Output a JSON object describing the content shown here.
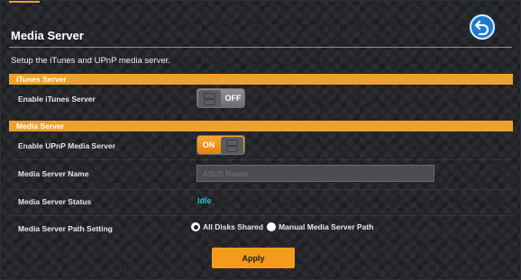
{
  "header": {
    "title": "Media Server",
    "subtitle": "Setup the iTunes and UPnP media server."
  },
  "back_button": {
    "icon": "back-arrow-icon"
  },
  "itunes_section": {
    "title": "iTunes Server",
    "enable_label": "Enable iTunes Server",
    "enable_state": "OFF"
  },
  "media_section": {
    "title": "Media Server",
    "upnp_label": "Enable UPnP Media Server",
    "upnp_state": "ON",
    "name_label": "Media Server Name",
    "name_value": "",
    "name_placeholder": "ASUS Router",
    "status_label": "Media Server Status",
    "status_value": "Idle",
    "path_label": "Media Server Path Setting",
    "path_options": [
      {
        "label": "All Disks Shared",
        "checked": true
      },
      {
        "label": "Manual Media Server Path",
        "checked": false
      }
    ]
  },
  "apply_label": "Apply",
  "colors": {
    "accent": "#f0a030",
    "status": "#21c3d6",
    "back_button": "#1f7ad1"
  }
}
